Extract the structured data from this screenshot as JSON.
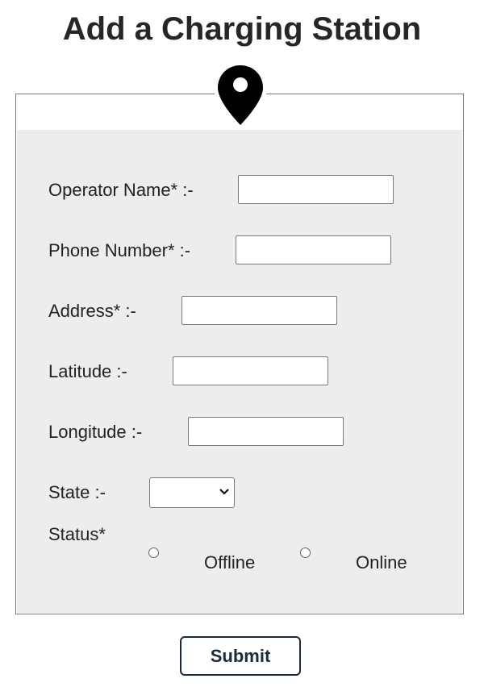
{
  "page": {
    "title": "Add a Charging Station",
    "icon": "map-pin-icon"
  },
  "form": {
    "operator_name": {
      "label": "Operator Name* :-",
      "value": ""
    },
    "phone_number": {
      "label": "Phone Number* :-",
      "value": ""
    },
    "address": {
      "label": "Address* :-",
      "value": ""
    },
    "latitude": {
      "label": "Latitude :-",
      "value": ""
    },
    "longitude": {
      "label": "Longitude :-",
      "value": ""
    },
    "state": {
      "label": "State :-",
      "selected": ""
    },
    "status": {
      "label": "Status*",
      "options": [
        {
          "label": "Offline",
          "checked": false
        },
        {
          "label": "Online",
          "checked": false
        }
      ]
    },
    "submit_label": "Submit"
  },
  "colors": {
    "panel_bg": "#ededed",
    "title_text": "#262626",
    "button_border": "#1c2b3a"
  }
}
